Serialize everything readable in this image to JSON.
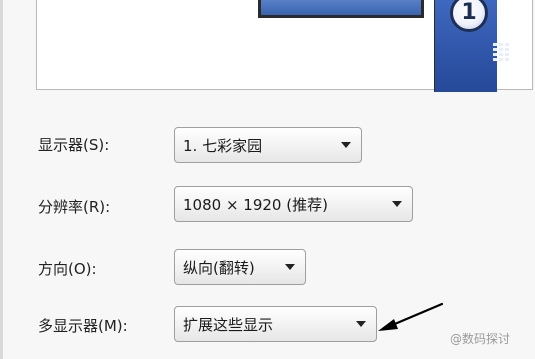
{
  "preview": {
    "monitor_number": "1"
  },
  "settings": {
    "display": {
      "label": "显示器(S):",
      "value": "1. 七彩家园"
    },
    "resolution": {
      "label": "分辨率(R):",
      "value": "1080 × 1920 (推荐)"
    },
    "orientation": {
      "label": "方向(O):",
      "value": "纵向(翻转)"
    },
    "multiple_displays": {
      "label": "多显示器(M):",
      "value": "扩展这些显示"
    }
  },
  "watermark": {
    "text": "@数码探讨"
  },
  "colors": {
    "monitor_blue": "#3a63b0",
    "annotation_arrow": "#000000"
  },
  "icons": {
    "dropdown": "chevron-down-icon",
    "annotation": "arrow-pointer-icon"
  }
}
